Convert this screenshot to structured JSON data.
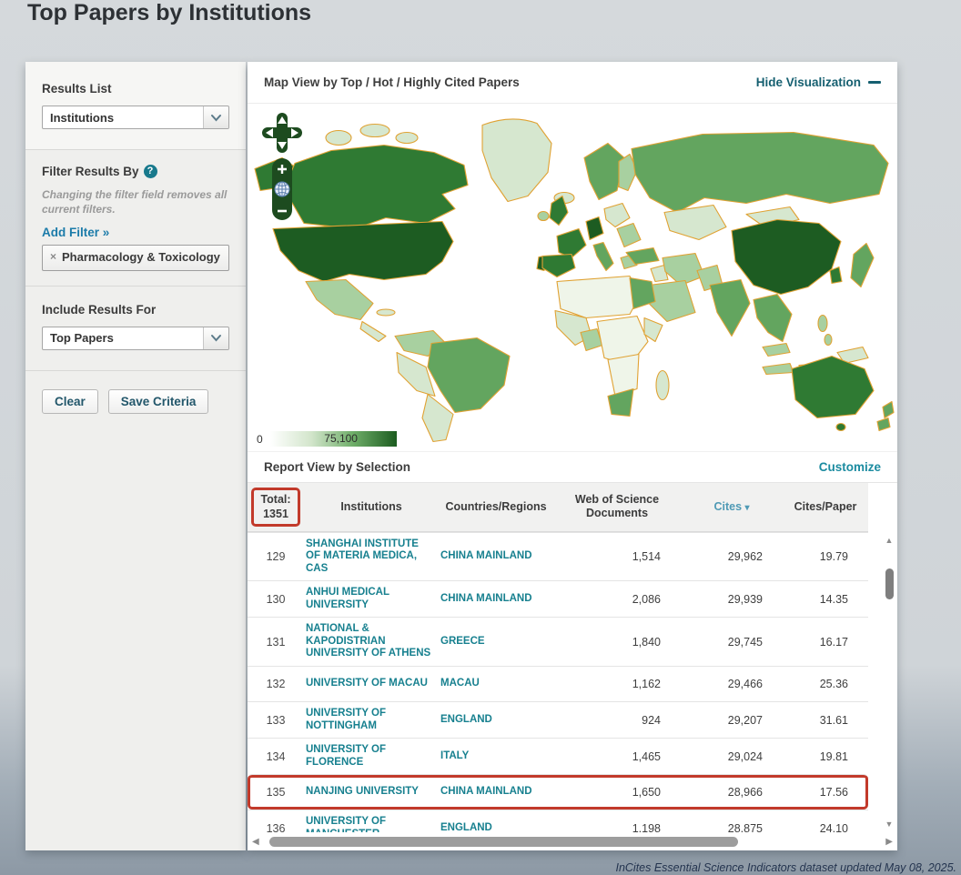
{
  "page": {
    "title": "Top Papers by Institutions",
    "footer": "InCites Essential Science Indicators dataset updated May 08, 2025."
  },
  "icons": {
    "chevron_down": "v-chevron",
    "question": "?",
    "remove": "×",
    "sort_desc": "▾",
    "scroll_up": "▲",
    "scroll_down": "▼",
    "scroll_left": "◀",
    "scroll_right": "▶"
  },
  "sidebar": {
    "results_list_label": "Results List",
    "results_list_value": "Institutions",
    "filter_section": {
      "label": "Filter Results By",
      "note": "Changing the filter field removes all current filters.",
      "add_filter_label": "Add Filter »",
      "active_filter": "Pharmacology & Toxicology"
    },
    "include_results_label": "Include Results For",
    "include_results_value": "Top Papers",
    "buttons": {
      "clear": "Clear",
      "save": "Save Criteria"
    }
  },
  "map_panel": {
    "header": "Map View by Top / Hot / Highly Cited Papers",
    "hide_visualization_label": "Hide Visualization",
    "legend": {
      "min": "0",
      "max": "75,100"
    },
    "controls": [
      "pan-up",
      "pan-left",
      "pan-right",
      "pan-down",
      "zoom-in",
      "globe",
      "zoom-out"
    ]
  },
  "report": {
    "header": "Report View by Selection",
    "customize_label": "Customize",
    "table": {
      "total_label": "Total:",
      "total_value": "1351",
      "columns": [
        "Institutions",
        "Countries/Regions",
        "Web of Science Documents",
        "Cites",
        "Cites/Paper"
      ],
      "sorted_column": "Cites",
      "rows": [
        {
          "rank": "129",
          "institution": "SHANGHAI INSTITUTE OF MATERIA MEDICA, CAS",
          "country": "CHINA MAINLAND",
          "documents": "1,514",
          "cites": "29,962",
          "cites_per_paper": "19.79",
          "highlighted": false
        },
        {
          "rank": "130",
          "institution": "ANHUI MEDICAL UNIVERSITY",
          "country": "CHINA MAINLAND",
          "documents": "2,086",
          "cites": "29,939",
          "cites_per_paper": "14.35",
          "highlighted": false
        },
        {
          "rank": "131",
          "institution": "NATIONAL & KAPODISTRIAN UNIVERSITY OF ATHENS",
          "country": "GREECE",
          "documents": "1,840",
          "cites": "29,745",
          "cites_per_paper": "16.17",
          "highlighted": false
        },
        {
          "rank": "132",
          "institution": "UNIVERSITY OF MACAU",
          "country": "MACAU",
          "documents": "1,162",
          "cites": "29,466",
          "cites_per_paper": "25.36",
          "highlighted": false
        },
        {
          "rank": "133",
          "institution": "UNIVERSITY OF NOTTINGHAM",
          "country": "ENGLAND",
          "documents": "924",
          "cites": "29,207",
          "cites_per_paper": "31.61",
          "highlighted": false
        },
        {
          "rank": "134",
          "institution": "UNIVERSITY OF FLORENCE",
          "country": "ITALY",
          "documents": "1,465",
          "cites": "29,024",
          "cites_per_paper": "19.81",
          "highlighted": false
        },
        {
          "rank": "135",
          "institution": "NANJING UNIVERSITY",
          "country": "CHINA MAINLAND",
          "documents": "1,650",
          "cites": "28,966",
          "cites_per_paper": "17.56",
          "highlighted": true
        },
        {
          "rank": "136",
          "institution": "UNIVERSITY OF MANCHESTER",
          "country": "ENGLAND",
          "documents": "1,198",
          "cites": "28,875",
          "cites_per_paper": "24.10",
          "highlighted": false
        }
      ]
    }
  },
  "colors": {
    "accent_teal": "#17808F",
    "link_blue": "#1B7BA9",
    "highlight_red": "#C23A2B",
    "choropleth_low": "#FFFFFF",
    "choropleth_high": "#1C5C20",
    "country_border_orange": "#E0A233",
    "footer_navy": "#24344F"
  }
}
